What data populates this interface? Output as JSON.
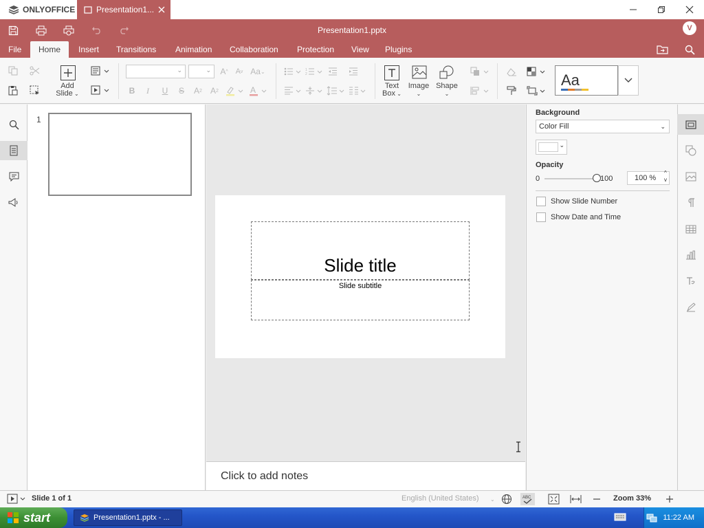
{
  "app": {
    "brand": "ONLYOFFICE",
    "tab_title": "Presentation1....",
    "doc_title": "Presentation1.pptx",
    "user_initial": "V"
  },
  "menu": [
    {
      "label": "File"
    },
    {
      "label": "Home"
    },
    {
      "label": "Insert"
    },
    {
      "label": "Transitions"
    },
    {
      "label": "Animation"
    },
    {
      "label": "Collaboration"
    },
    {
      "label": "Protection"
    },
    {
      "label": "View"
    },
    {
      "label": "Plugins"
    }
  ],
  "toolbar": {
    "add_slide_l1": "Add",
    "add_slide_l2": "Slide",
    "text_box_l1": "Text",
    "text_box_l2": "Box",
    "image": "Image",
    "shape": "Shape",
    "theme_preview": "Aa",
    "font_name": "",
    "font_size": ""
  },
  "thumbnails": [
    {
      "number": "1"
    }
  ],
  "slide": {
    "title": "Slide title",
    "subtitle": "Slide subtitle"
  },
  "notes": {
    "placeholder": "Click to add notes"
  },
  "right_panel": {
    "background_heading": "Background",
    "fill_type": "Color Fill",
    "opacity_heading": "Opacity",
    "opacity_min": "0",
    "opacity_max": "100",
    "opacity_value": "100 %",
    "opacity_level": 1.0,
    "show_slide_number": "Show Slide Number",
    "show_date_time": "Show Date and Time"
  },
  "status": {
    "slide_counter": "Slide 1 of 1",
    "language": "English (United States)",
    "zoom": "Zoom 33%"
  },
  "taskbar": {
    "start": "start",
    "item": "Presentation1.pptx - ...",
    "clock": "11:22 AM"
  },
  "colors": {
    "accent": "#b75d5d",
    "taskbar": "#245edb",
    "start": "#3c8f34"
  }
}
